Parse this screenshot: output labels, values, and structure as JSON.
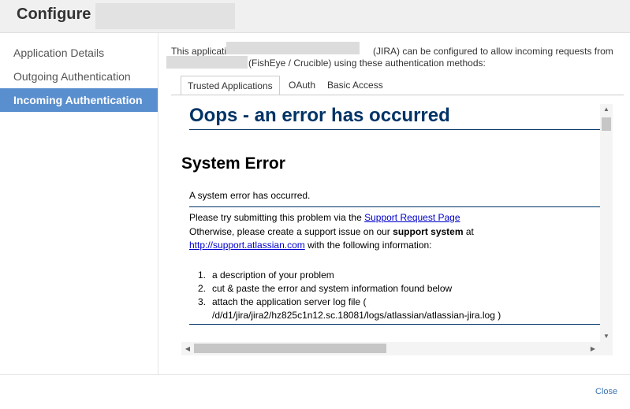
{
  "dialog": {
    "title": "Configure"
  },
  "sidebar": {
    "items": [
      {
        "label": "Application Details",
        "active": false
      },
      {
        "label": "Outgoing Authentication",
        "active": false
      },
      {
        "label": "Incoming Authentication",
        "active": true
      }
    ]
  },
  "intro": {
    "line1_a": "This application",
    "line1_b": "(JIRA) can be configured to allow incoming requests from",
    "line2": "(FishEye / Crucible) using these authentication methods:"
  },
  "tabs": [
    {
      "label": "Trusted Applications",
      "active": true
    },
    {
      "label": "OAuth",
      "active": false
    },
    {
      "label": "Basic Access",
      "active": false
    }
  ],
  "error": {
    "heading": "Oops - an error has occurred",
    "subheading": "System Error",
    "message": "A system error has occurred.",
    "try_text": "Please try submitting this problem via the",
    "support_link": "Support Request Page",
    "otherwise_text": "Otherwise, please create a support issue on our",
    "support_system": "support system",
    "at_text": "at",
    "url_link": "http://support.atlassian.com",
    "following_text": "with the following information:",
    "list": [
      {
        "num": "1.",
        "text": "a description of your problem"
      },
      {
        "num": "2.",
        "text": "cut & paste the error and system information found below"
      },
      {
        "num": "3.",
        "text": "attach the application server log file ("
      }
    ],
    "log_path": "/d/d1/jira/jira2/hz825c1n12.sc.18081/logs/atlassian/atlassian-jira.log )"
  },
  "footer": {
    "close_label": "Close"
  },
  "colors": {
    "active_nav": "#5a8fcf",
    "heading": "#003366",
    "link": "#0000cc",
    "close_link": "#3b73af"
  },
  "icons": {
    "scroll_up": "triangle-up",
    "scroll_down": "triangle-down",
    "scroll_left": "triangle-left",
    "scroll_right": "triangle-right"
  }
}
